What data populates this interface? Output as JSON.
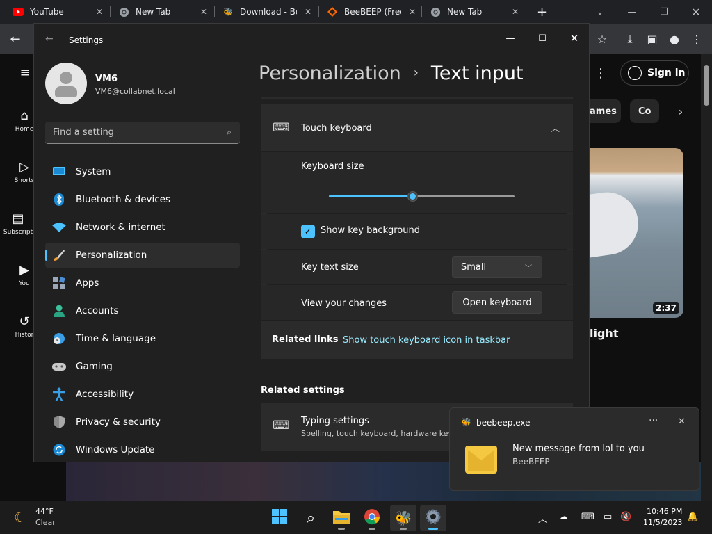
{
  "browser": {
    "tabs": [
      {
        "title": "YouTube",
        "icon": "youtube-icon"
      },
      {
        "title": "New Tab",
        "icon": "chrome-icon"
      },
      {
        "title": "Download - Be",
        "icon": "beebeep-icon"
      },
      {
        "title": "BeeBEEP (Free",
        "icon": "sourceforge-icon"
      },
      {
        "title": "New Tab",
        "icon": "chrome-icon"
      }
    ],
    "new_tab": "+"
  },
  "youtube": {
    "nav": [
      "Home",
      "Shorts",
      "Subscript",
      "You",
      "Histor"
    ],
    "signin": "Sign in",
    "chips": [
      "ames",
      "Co"
    ],
    "video_duration": "2:37",
    "video_title": "light"
  },
  "settings": {
    "app_title": "Settings",
    "user": {
      "name": "VM6",
      "email": "VM6@collabnet.local"
    },
    "search_placeholder": "Find a setting",
    "nav": [
      {
        "label": "System",
        "icon": "system-icon"
      },
      {
        "label": "Bluetooth & devices",
        "icon": "bluetooth-icon"
      },
      {
        "label": "Network & internet",
        "icon": "wifi-icon"
      },
      {
        "label": "Personalization",
        "icon": "brush-icon",
        "active": true
      },
      {
        "label": "Apps",
        "icon": "apps-icon"
      },
      {
        "label": "Accounts",
        "icon": "accounts-icon"
      },
      {
        "label": "Time & language",
        "icon": "clock-globe-icon"
      },
      {
        "label": "Gaming",
        "icon": "gamepad-icon"
      },
      {
        "label": "Accessibility",
        "icon": "accessibility-icon"
      },
      {
        "label": "Privacy & security",
        "icon": "shield-icon"
      },
      {
        "label": "Windows Update",
        "icon": "update-icon"
      }
    ],
    "breadcrumb_parent": "Personalization",
    "page_title": "Text input",
    "touch_keyboard": {
      "header": "Touch keyboard",
      "keyboard_size_label": "Keyboard size",
      "keyboard_size_value": 0.45,
      "show_key_background_label": "Show key background",
      "show_key_background_checked": true,
      "key_text_size_label": "Key text size",
      "key_text_size_value": "Small",
      "view_changes_label": "View your changes",
      "open_keyboard_button": "Open keyboard",
      "related_links_label": "Related links",
      "related_link": "Show touch keyboard icon in taskbar"
    },
    "related_settings": {
      "heading": "Related settings",
      "typing_title": "Typing settings",
      "typing_sub": "Spelling, touch keyboard, hardware key"
    }
  },
  "toast": {
    "app": "beebeep.exe",
    "message": "New message from lol to you",
    "sender": "BeeBEEP"
  },
  "taskbar": {
    "weather_temp": "44°F",
    "weather_cond": "Clear",
    "time": "10:46 PM",
    "date": "11/5/2023"
  },
  "colors": {
    "accent": "#4cc2ff",
    "link": "#99ebff",
    "panel": "#202020",
    "card": "#2b2b2b"
  }
}
